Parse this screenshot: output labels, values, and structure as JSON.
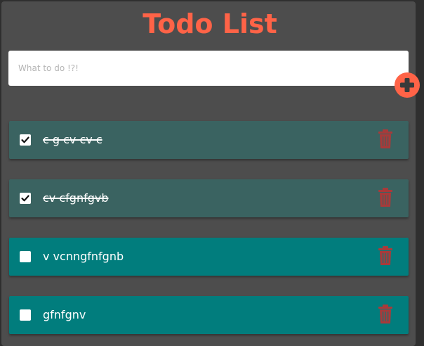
{
  "header": {
    "title": "Todo List"
  },
  "input": {
    "placeholder": "What to do !?!",
    "value": ""
  },
  "add_button": {
    "icon": "plus-circle-icon"
  },
  "colors": {
    "accent": "#ff6347",
    "panel": "#4d4d4d",
    "todo_done": "#3a6361",
    "todo_open": "#017d7d",
    "trash": "#a83a3a"
  },
  "todos": [
    {
      "text": "c g cv cv c",
      "completed": true
    },
    {
      "text": "cv cfgnfgvb",
      "completed": true
    },
    {
      "text": "v vcnngfnfgnb",
      "completed": false
    },
    {
      "text": "gfnfgnv",
      "completed": false
    }
  ]
}
